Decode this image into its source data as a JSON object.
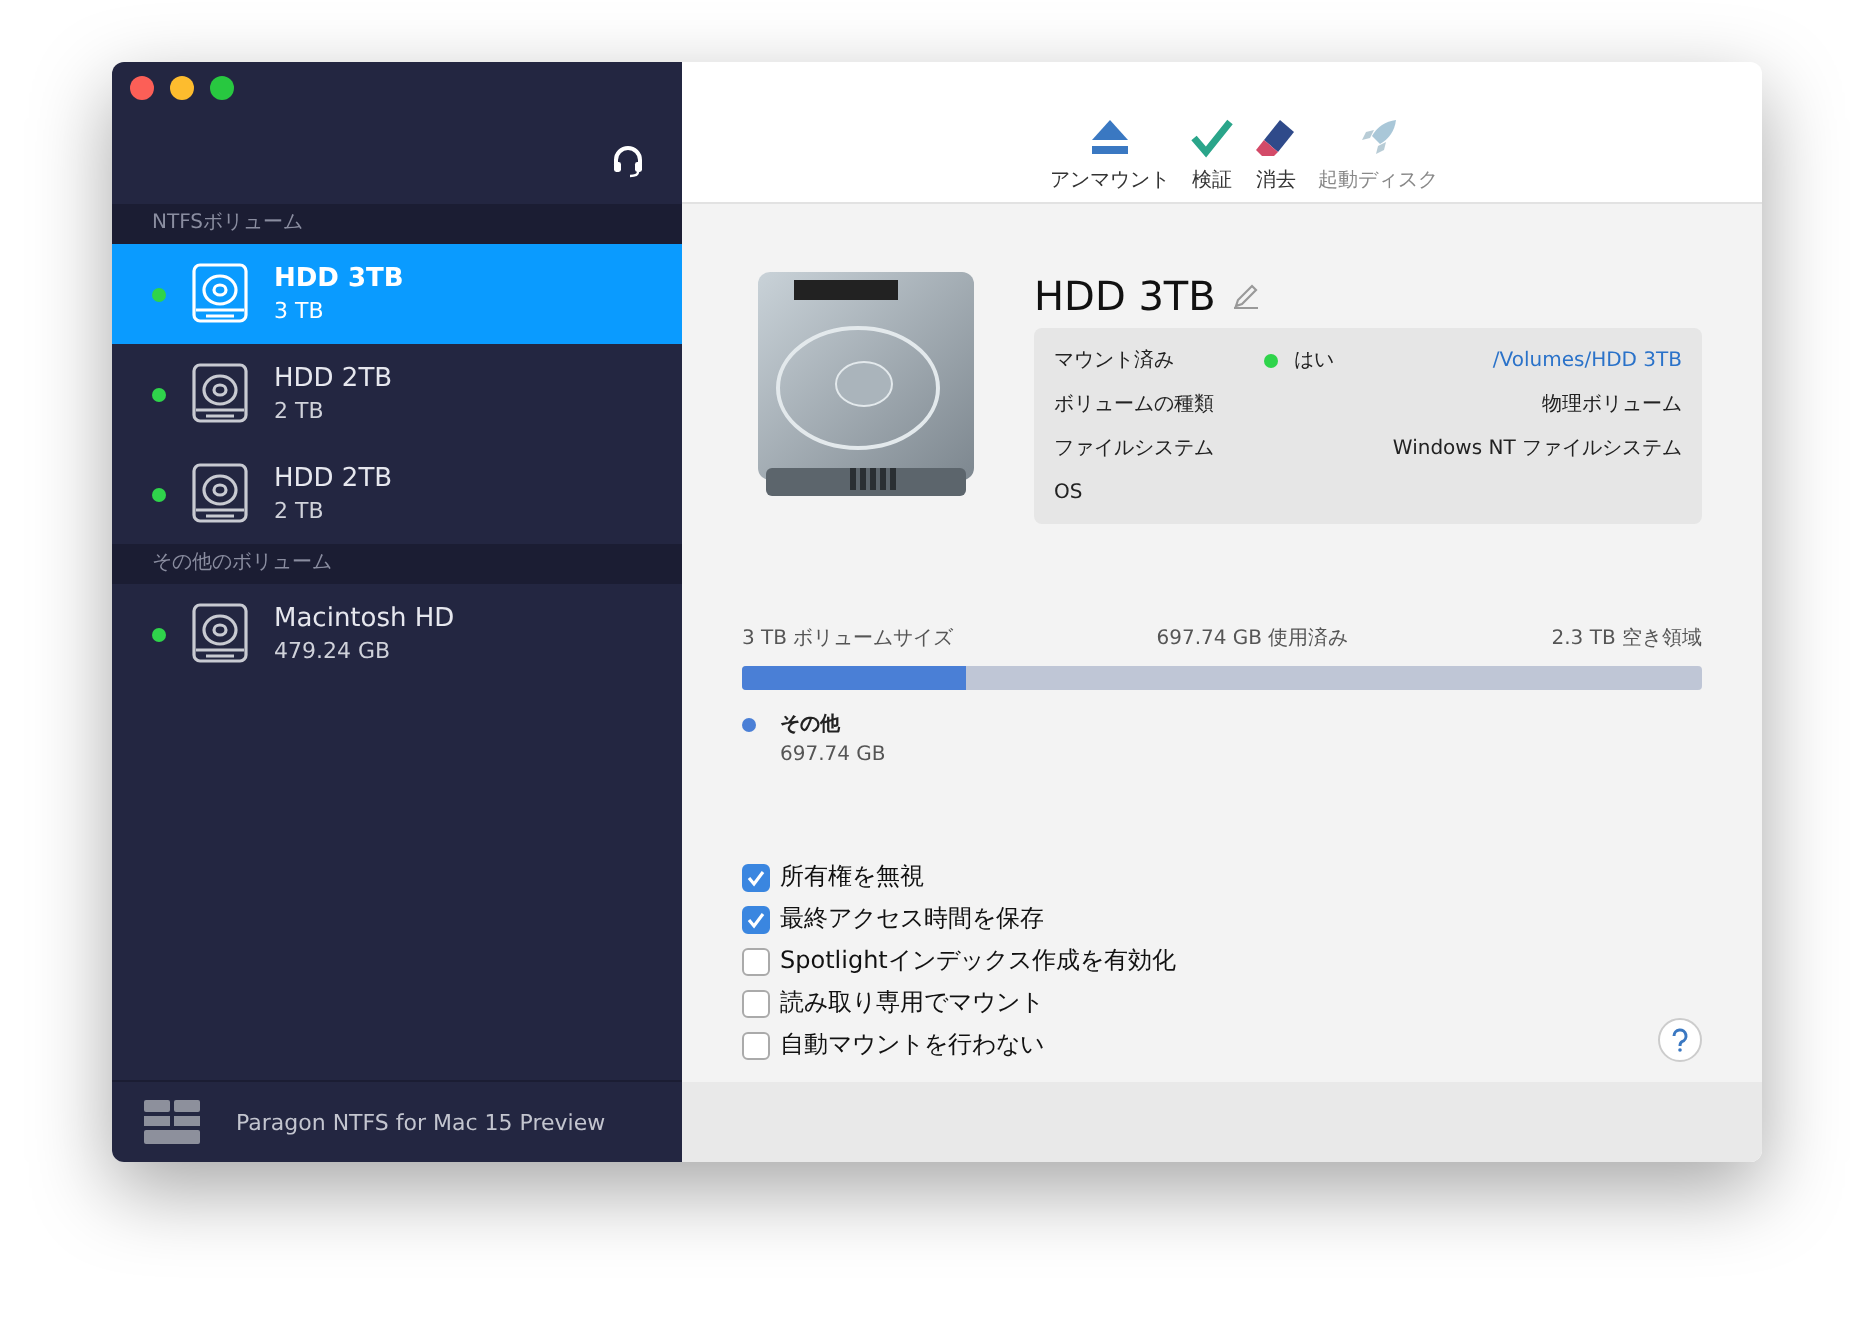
{
  "sidebar": {
    "sections": [
      {
        "title": "NTFSボリューム",
        "volumes": [
          {
            "name": "HDD 3TB",
            "size": "3 TB",
            "mounted": true,
            "selected": true
          },
          {
            "name": "HDD 2TB",
            "size": "2 TB",
            "mounted": true,
            "selected": false
          },
          {
            "name": "HDD 2TB",
            "size": "2 TB",
            "mounted": true,
            "selected": false
          }
        ]
      },
      {
        "title": "その他のボリューム",
        "volumes": [
          {
            "name": "Macintosh HD",
            "size": "479.24 GB",
            "mounted": true,
            "selected": false
          }
        ]
      }
    ],
    "footer": "Paragon NTFS for Mac 15 Preview"
  },
  "toolbar": [
    {
      "kind": "eject",
      "label": "アンマウント",
      "disabled": false
    },
    {
      "kind": "verify",
      "label": "検証",
      "disabled": false
    },
    {
      "kind": "erase",
      "label": "消去",
      "disabled": false
    },
    {
      "kind": "startup",
      "label": "起動ディスク",
      "disabled": true
    }
  ],
  "volume": {
    "name": "HDD 3TB",
    "info": [
      {
        "label": "マウント済み",
        "status": "はい",
        "mounted": true,
        "value": "/Volumes/HDD 3TB",
        "kind": "link"
      },
      {
        "label": "ボリュームの種類",
        "value": "物理ボリューム",
        "kind": "text"
      },
      {
        "label": "ファイルシステム",
        "value": "Windows NT ファイルシステム",
        "kind": "text"
      },
      {
        "label": "OS"
      }
    ]
  },
  "usage": {
    "size_label": "3 TB ボリュームサイズ",
    "used_label": "697.74 GB 使用済み",
    "free_label": "2.3 TB 空き領域",
    "level": 0.233,
    "legend": [
      {
        "name": "その他",
        "value": "697.74 GB",
        "color": "#4a7fd6"
      }
    ]
  },
  "options": [
    {
      "label": "所有権を無視",
      "checked": true
    },
    {
      "label": "最終アクセス時間を保存",
      "checked": true
    },
    {
      "label": "Spotlightインデックス作成を有効化",
      "checked": false
    },
    {
      "label": "読み取り専用でマウント",
      "checked": false
    },
    {
      "label": "自動マウントを行わない",
      "checked": false
    }
  ]
}
